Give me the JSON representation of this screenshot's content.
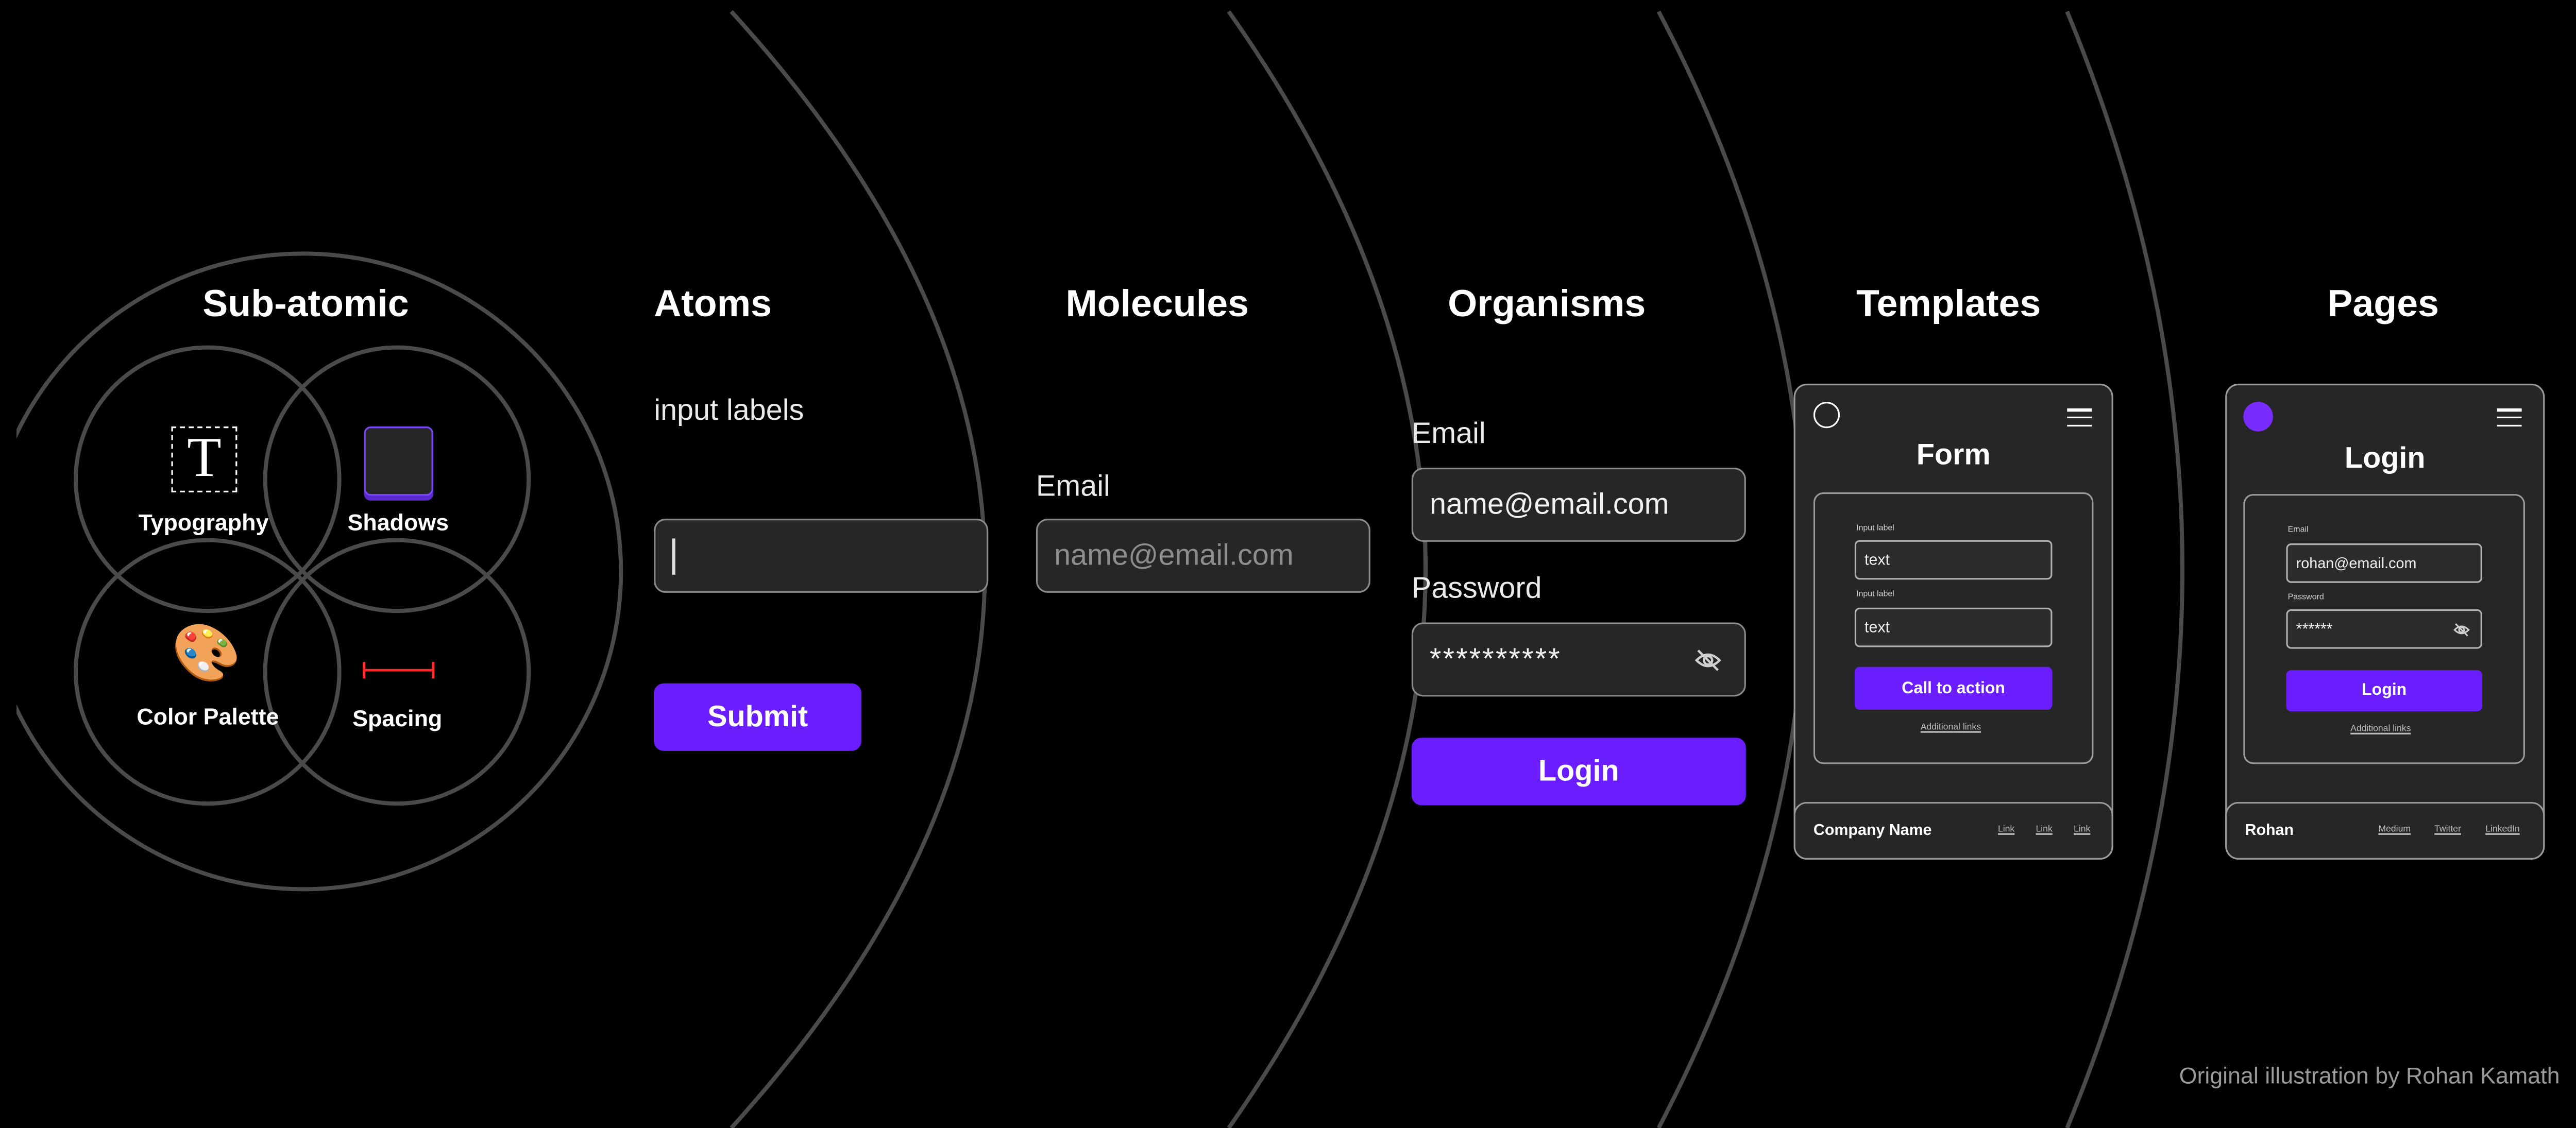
{
  "subatomic": {
    "title": "Sub-atomic",
    "typography_glyph": "T",
    "typography_label": "Typography",
    "shadows_label": "Shadows",
    "color_palette_label": "Color Palette",
    "spacing_label": "Spacing",
    "palette_emoji": "🎨"
  },
  "atoms": {
    "title": "Atoms",
    "input_label": "input labels",
    "submit_label": "Submit"
  },
  "molecules": {
    "title": "Molecules",
    "email_label": "Email",
    "email_placeholder": "name@email.com"
  },
  "organisms": {
    "title": "Organisms",
    "email_label": "Email",
    "email_value": "name@email.com",
    "password_label": "Password",
    "password_value": "**********",
    "login_label": "Login"
  },
  "templates": {
    "title": "Templates",
    "card_title": "Form",
    "field1_label": "Input label",
    "field1_value": "text",
    "field2_label": "Input label",
    "field2_value": "text",
    "cta_label": "Call to action",
    "additional_links": "Additional links",
    "footer_name": "Company Name",
    "footer_links": [
      "Link",
      "Link",
      "Link"
    ]
  },
  "pages": {
    "title": "Pages",
    "card_title": "Login",
    "field1_label": "Email",
    "field1_value": "rohan@email.com",
    "field2_label": "Password",
    "field2_value": "******",
    "login_label": "Login",
    "additional_links": "Additional links",
    "footer_name": "Rohan",
    "footer_links": [
      "Medium",
      "Twitter",
      "LinkedIn"
    ]
  },
  "credit": "Original illustration by Rohan Kamath",
  "colors": {
    "background": "#000000",
    "accent": "#6a1dff",
    "ring": "#4a4a4a",
    "surface": "#262626"
  }
}
